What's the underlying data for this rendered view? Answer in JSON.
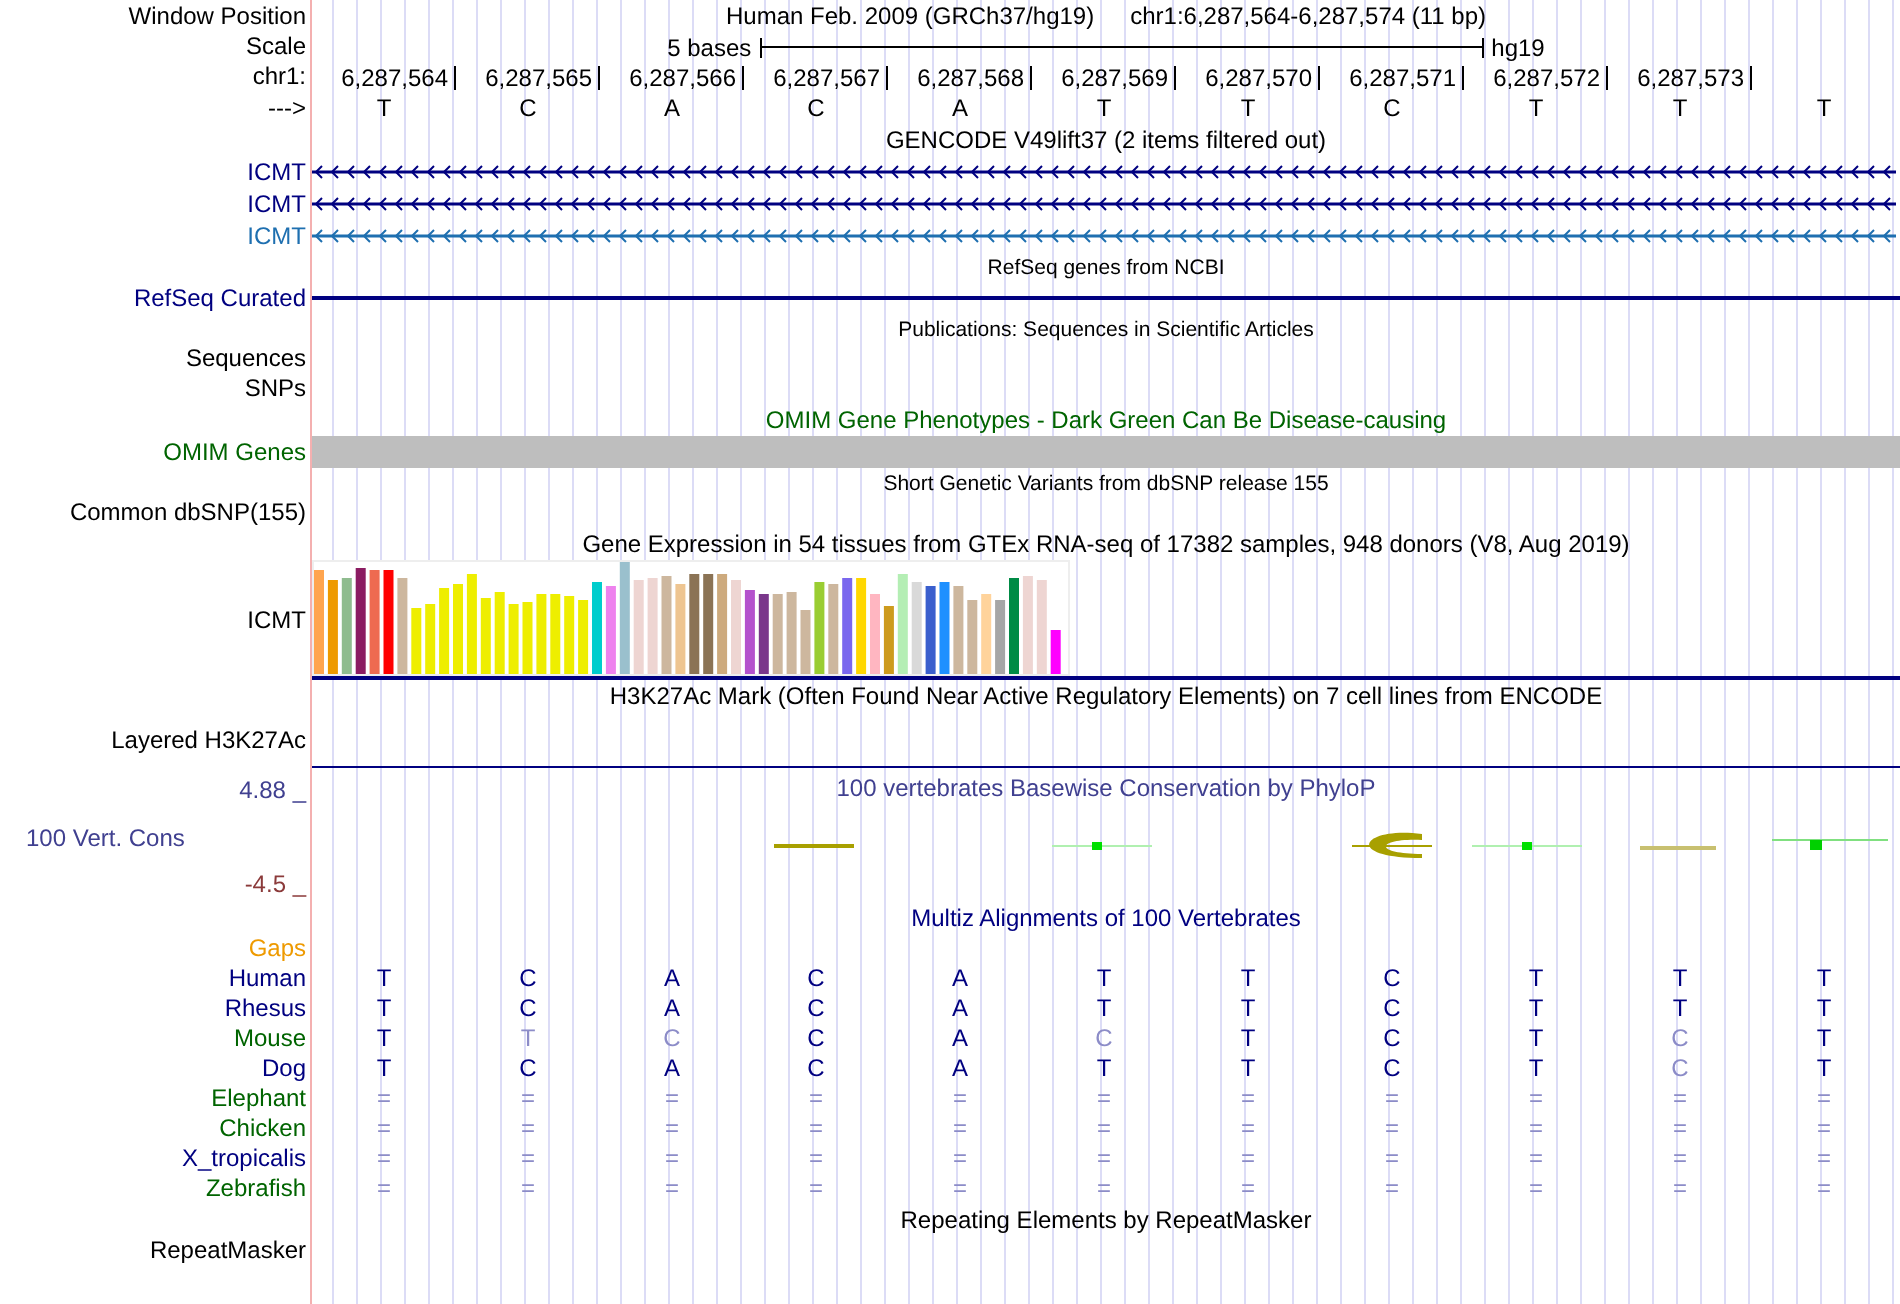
{
  "rows": [
    {
      "kind": "position",
      "label": "Window Position",
      "assembly": "Human Feb. 2009 (GRCh37/hg19)",
      "range": "chr1:6,287,564-6,287,574 (11 bp)"
    },
    {
      "kind": "scale",
      "label": "Scale",
      "text": "5 bases",
      "assembly": "hg19"
    },
    {
      "kind": "ruler",
      "label": "chr1:",
      "ticks": [
        "6,287,564",
        "6,287,565",
        "6,287,566",
        "6,287,567",
        "6,287,568",
        "6,287,569",
        "6,287,570",
        "6,287,571",
        "6,287,572",
        "6,287,573"
      ]
    },
    {
      "kind": "bases",
      "label": "--->",
      "bases": [
        "T",
        "C",
        "A",
        "C",
        "A",
        "T",
        "T",
        "C",
        "T",
        "T",
        "T"
      ]
    },
    {
      "kind": "heading",
      "small": false,
      "color": "#000000",
      "text": "GENCODE V49lift37 (2 items filtered out)"
    },
    {
      "kind": "gene",
      "label": "ICMT",
      "color": "#000080"
    },
    {
      "kind": "gene",
      "label": "ICMT",
      "color": "#000080"
    },
    {
      "kind": "gene",
      "label": "ICMT",
      "color": "#1e6fb0"
    },
    {
      "kind": "heading",
      "small": true,
      "color": "#000000",
      "text": "RefSeq genes from NCBI"
    },
    {
      "kind": "line",
      "label": "RefSeq Curated",
      "color": "#000080"
    },
    {
      "kind": "heading",
      "small": true,
      "color": "#000000",
      "text": "Publications: Sequences in Scientific Articles"
    },
    {
      "kind": "empty",
      "label": "Sequences",
      "color": "#000000"
    },
    {
      "kind": "empty",
      "label": "SNPs",
      "color": "#000000"
    },
    {
      "kind": "heading",
      "small": false,
      "color": "#006400",
      "text": "OMIM Gene Phenotypes - Dark Green Can Be Disease-causing"
    },
    {
      "kind": "bar",
      "label": "OMIM Genes",
      "color": "#006400"
    },
    {
      "kind": "heading",
      "small": true,
      "color": "#000000",
      "text": "Short Genetic Variants from dbSNP release 155"
    },
    {
      "kind": "empty",
      "label": "Common dbSNP(155)",
      "color": "#000000"
    },
    {
      "kind": "heading",
      "small": false,
      "color": "#000000",
      "text": "Gene Expression in 54 tissues from GTEx RNA-seq of 17382 samples, 948 donors (V8, Aug 2019)"
    },
    {
      "kind": "expression",
      "label": "ICMT",
      "color": "#000000"
    },
    {
      "kind": "heading",
      "small": false,
      "color": "#000000",
      "text": "H3K27Ac Mark (Often Found Near Active Regulatory Elements) on 7 cell lines from ENCODE"
    },
    {
      "kind": "layered",
      "label": "Layered H3K27Ac",
      "color": "#000000"
    },
    {
      "kind": "conservation",
      "upper": "4.88 _",
      "label": "100 Vert. Cons",
      "lower": "-4.5 _",
      "title": "100 vertebrates Basewise Conservation by PhyloP"
    },
    {
      "kind": "heading",
      "small": false,
      "color": "#000080",
      "text": "Multiz Alignments of 100 Vertebrates"
    },
    {
      "kind": "empty",
      "label": "Gaps",
      "color": "#ee9a00"
    },
    {
      "kind": "alignment",
      "species": [
        {
          "name": "Human",
          "color": "#000080",
          "bases": [
            {
              "base": "T",
              "dim": false
            },
            {
              "base": "C",
              "dim": false
            },
            {
              "base": "A",
              "dim": false
            },
            {
              "base": "C",
              "dim": false
            },
            {
              "base": "A",
              "dim": false
            },
            {
              "base": "T",
              "dim": false
            },
            {
              "base": "T",
              "dim": false
            },
            {
              "base": "C",
              "dim": false
            },
            {
              "base": "T",
              "dim": false
            },
            {
              "base": "T",
              "dim": false
            },
            {
              "base": "T",
              "dim": false
            }
          ]
        },
        {
          "name": "Rhesus",
          "color": "#000080",
          "bases": [
            {
              "base": "T",
              "dim": false
            },
            {
              "base": "C",
              "dim": false
            },
            {
              "base": "A",
              "dim": false
            },
            {
              "base": "C",
              "dim": false
            },
            {
              "base": "A",
              "dim": false
            },
            {
              "base": "T",
              "dim": false
            },
            {
              "base": "T",
              "dim": false
            },
            {
              "base": "C",
              "dim": false
            },
            {
              "base": "T",
              "dim": false
            },
            {
              "base": "T",
              "dim": false
            },
            {
              "base": "T",
              "dim": false
            }
          ]
        },
        {
          "name": "Mouse",
          "color": "#006400",
          "bases": [
            {
              "base": "T",
              "dim": false
            },
            {
              "base": "T",
              "dim": true
            },
            {
              "base": "C",
              "dim": true
            },
            {
              "base": "C",
              "dim": false
            },
            {
              "base": "A",
              "dim": false
            },
            {
              "base": "C",
              "dim": true
            },
            {
              "base": "T",
              "dim": false
            },
            {
              "base": "C",
              "dim": false
            },
            {
              "base": "T",
              "dim": false
            },
            {
              "base": "C",
              "dim": true
            },
            {
              "base": "T",
              "dim": false
            }
          ]
        },
        {
          "name": "Dog",
          "color": "#000080",
          "bases": [
            {
              "base": "T",
              "dim": false
            },
            {
              "base": "C",
              "dim": false
            },
            {
              "base": "A",
              "dim": false
            },
            {
              "base": "C",
              "dim": false
            },
            {
              "base": "A",
              "dim": false
            },
            {
              "base": "T",
              "dim": false
            },
            {
              "base": "T",
              "dim": false
            },
            {
              "base": "C",
              "dim": false
            },
            {
              "base": "T",
              "dim": false
            },
            {
              "base": "C",
              "dim": true
            },
            {
              "base": "T",
              "dim": false
            }
          ]
        },
        {
          "name": "Elephant",
          "color": "#006400",
          "bases": [
            {
              "base": "=",
              "dim": true
            },
            {
              "base": "=",
              "dim": true
            },
            {
              "base": "=",
              "dim": true
            },
            {
              "base": "=",
              "dim": true
            },
            {
              "base": "=",
              "dim": true
            },
            {
              "base": "=",
              "dim": true
            },
            {
              "base": "=",
              "dim": true
            },
            {
              "base": "=",
              "dim": true
            },
            {
              "base": "=",
              "dim": true
            },
            {
              "base": "=",
              "dim": true
            },
            {
              "base": "=",
              "dim": true
            }
          ]
        },
        {
          "name": "Chicken",
          "color": "#006400",
          "bases": [
            {
              "base": "=",
              "dim": true
            },
            {
              "base": "=",
              "dim": true
            },
            {
              "base": "=",
              "dim": true
            },
            {
              "base": "=",
              "dim": true
            },
            {
              "base": "=",
              "dim": true
            },
            {
              "base": "=",
              "dim": true
            },
            {
              "base": "=",
              "dim": true
            },
            {
              "base": "=",
              "dim": true
            },
            {
              "base": "=",
              "dim": true
            },
            {
              "base": "=",
              "dim": true
            },
            {
              "base": "=",
              "dim": true
            }
          ]
        },
        {
          "name": "X_tropicalis",
          "color": "#000080",
          "bases": [
            {
              "base": "=",
              "dim": true
            },
            {
              "base": "=",
              "dim": true
            },
            {
              "base": "=",
              "dim": true
            },
            {
              "base": "=",
              "dim": true
            },
            {
              "base": "=",
              "dim": true
            },
            {
              "base": "=",
              "dim": true
            },
            {
              "base": "=",
              "dim": true
            },
            {
              "base": "=",
              "dim": true
            },
            {
              "base": "=",
              "dim": true
            },
            {
              "base": "=",
              "dim": true
            },
            {
              "base": "=",
              "dim": true
            }
          ]
        },
        {
          "name": "Zebrafish",
          "color": "#006400",
          "bases": [
            {
              "base": "=",
              "dim": true
            },
            {
              "base": "=",
              "dim": true
            },
            {
              "base": "=",
              "dim": true
            },
            {
              "base": "=",
              "dim": true
            },
            {
              "base": "=",
              "dim": true
            },
            {
              "base": "=",
              "dim": true
            },
            {
              "base": "=",
              "dim": true
            },
            {
              "base": "=",
              "dim": true
            },
            {
              "base": "=",
              "dim": true
            },
            {
              "base": "=",
              "dim": true
            },
            {
              "base": "=",
              "dim": true
            }
          ]
        }
      ]
    },
    {
      "kind": "heading",
      "small": false,
      "color": "#000000",
      "text": "Repeating Elements by RepeatMasker"
    },
    {
      "kind": "empty",
      "label": "RepeatMasker",
      "color": "#000000"
    }
  ]
}
